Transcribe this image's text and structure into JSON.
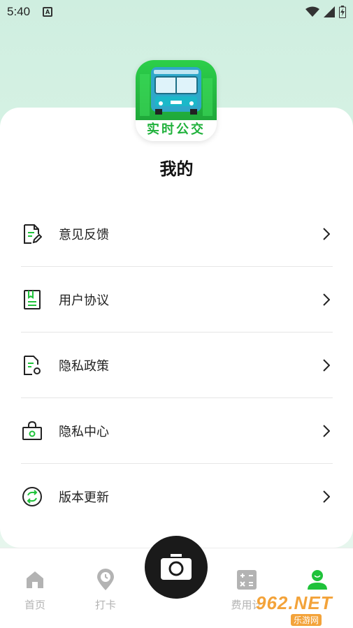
{
  "status_bar": {
    "time": "5:40",
    "notification_icon": "a-icon",
    "icons": [
      "wifi-icon",
      "signal-icon",
      "battery-icon"
    ]
  },
  "app": {
    "logo_text": "实时公交",
    "page_title": "我的"
  },
  "menu": {
    "items": [
      {
        "label": "意见反馈",
        "icon": "feedback-icon"
      },
      {
        "label": "用户协议",
        "icon": "agreement-icon"
      },
      {
        "label": "隐私政策",
        "icon": "privacy-policy-icon"
      },
      {
        "label": "隐私中心",
        "icon": "privacy-center-icon"
      },
      {
        "label": "版本更新",
        "icon": "update-icon"
      }
    ]
  },
  "tabbar": {
    "tabs": [
      {
        "label": "首页",
        "icon": "home-icon",
        "active": false
      },
      {
        "label": "打卡",
        "icon": "location-icon",
        "active": false
      },
      {
        "label": "费用计",
        "icon": "calculator-icon",
        "active": false
      },
      {
        "label": "",
        "icon": "profile-icon",
        "active": true
      }
    ],
    "center_button_icon": "camera-icon"
  },
  "watermark": {
    "top": "962.NET",
    "bottom": "乐游网"
  },
  "colors": {
    "accent": "#1fc23a",
    "inactive": "#b3b3b3",
    "camera_bg": "#1a1a1a"
  }
}
